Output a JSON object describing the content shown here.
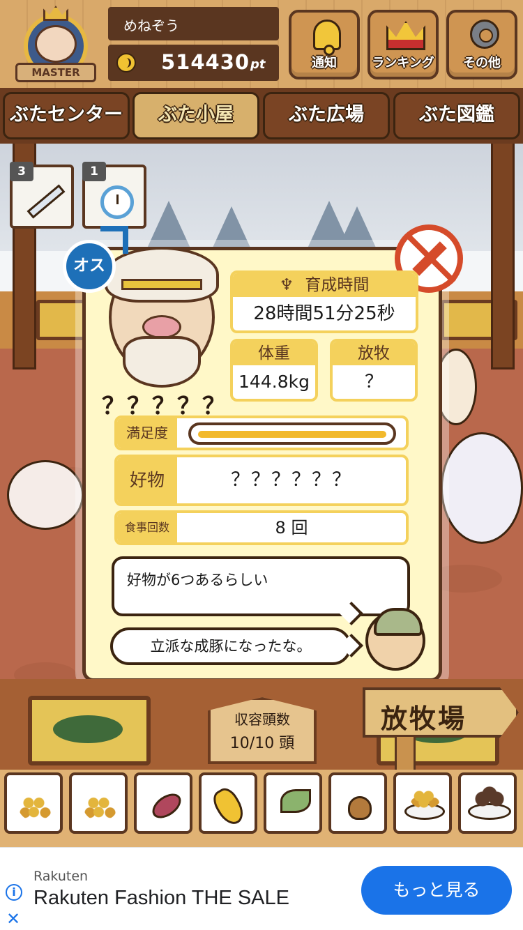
{
  "header": {
    "badge_label": "MASTER",
    "username": "めねぞう",
    "points": "514430",
    "points_unit": "pt",
    "buttons": [
      {
        "label": "通知",
        "icon": "bell-icon"
      },
      {
        "label": "ランキング",
        "icon": "crown-icon"
      },
      {
        "label": "その他",
        "icon": "gear-icon"
      }
    ]
  },
  "tabs": [
    {
      "label": "ぶたセンター",
      "active": false
    },
    {
      "label": "ぶた小屋",
      "active": true
    },
    {
      "label": "ぶた広場",
      "active": false
    },
    {
      "label": "ぶた図鑑",
      "active": false
    }
  ],
  "items": [
    {
      "count": "3",
      "icon": "syringe-icon"
    },
    {
      "count": "1",
      "icon": "stopwatch-icon"
    }
  ],
  "pig": {
    "gender_label": "オス",
    "name": "？？？？？",
    "raising_time_label": "育成時間",
    "raising_time": "28時間51分25秒",
    "weight_label": "体重",
    "weight": "144.8kg",
    "grazing_label": "放牧",
    "grazing": "？",
    "satisfaction_label": "満足度",
    "satisfaction_level": 1.0,
    "favorite_label": "好物",
    "favorite": "？？？？？？",
    "meals_label": "食事回数",
    "meals": "8 回"
  },
  "messages": {
    "hint": "好物が6つあるらしい",
    "farmer": "立派な成豚になったな。"
  },
  "capacity": {
    "label": "収容頭数",
    "value": "10/10 頭"
  },
  "pasture_sign": "放牧場",
  "foods": [
    "grain-icon",
    "mixed-grain-icon",
    "sweet-potato-icon",
    "corn-icon",
    "greens-icon",
    "acorn-icon",
    "plate-grain-icon",
    "dumpling-icon"
  ],
  "ad": {
    "brand": "Rakuten",
    "title": "Rakuten Fashion THE SALE",
    "button": "もっと見る",
    "info_symbol": "i",
    "close_symbol": "✕"
  },
  "colors": {
    "accent_yellow": "#f4d15c",
    "wood_dark": "#5a3620",
    "male_blue": "#1e70b8",
    "no_syringe_red": "#d54b2a",
    "ad_button": "#1a73e8"
  }
}
